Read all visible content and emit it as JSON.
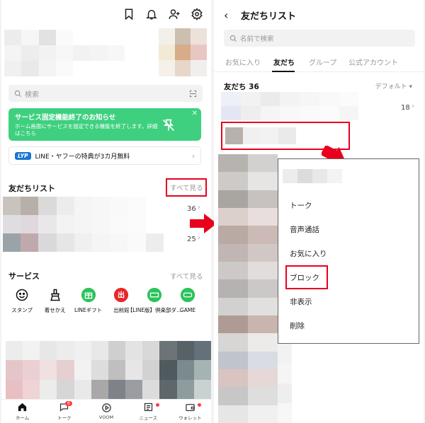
{
  "left": {
    "search": {
      "placeholder": "検索"
    },
    "notice": {
      "title": "サービス固定機能終了のお知らせ",
      "body": "ホーム画面にサービスを固定できる機能を終了します。詳細はこちら"
    },
    "promo": {
      "badge": "LYP",
      "text": "LINE・ヤフーの特典が3カ月無料"
    },
    "friends": {
      "title": "友だちリスト",
      "see_all": "すべて見る",
      "count_a": "36",
      "count_b": "25"
    },
    "services": {
      "title": "サービス",
      "see_all": "すべて見る",
      "items": [
        {
          "label": "スタンプ",
          "icon": "smiley-icon"
        },
        {
          "label": "着せかえ",
          "icon": "brush-icon"
        },
        {
          "label": "LINEギフト",
          "icon": "gift-icon"
        },
        {
          "label": "出前館",
          "icon": "demaecan-icon"
        },
        {
          "label": "【LINE版】倶楽部ダ…",
          "icon": "club-icon"
        },
        {
          "label": "GAME",
          "icon": "game-icon"
        }
      ]
    },
    "nav": [
      {
        "label": "ホーム",
        "icon": "home-icon"
      },
      {
        "label": "トーク",
        "icon": "chat-icon",
        "badge": "6"
      },
      {
        "label": "VOOM",
        "icon": "voom-icon"
      },
      {
        "label": "ニュース",
        "icon": "news-icon"
      },
      {
        "label": "ウォレット",
        "icon": "wallet-icon"
      }
    ]
  },
  "right": {
    "title": "友だちリスト",
    "search": {
      "placeholder": "名前で検索"
    },
    "tabs": [
      {
        "label": "お気に入り"
      },
      {
        "label": "友だち"
      },
      {
        "label": "グループ"
      },
      {
        "label": "公式アカウント"
      }
    ],
    "friends_header": "友だち 36",
    "sort": "デフォルト ▾",
    "count": "18",
    "menu": [
      "トーク",
      "音声通話",
      "お気に入り",
      "ブロック",
      "非表示",
      "削除"
    ]
  },
  "colors": {
    "accent_green": "#3ed07f",
    "highlight_red": "#e8001c",
    "line_blue": "#1976d2"
  }
}
